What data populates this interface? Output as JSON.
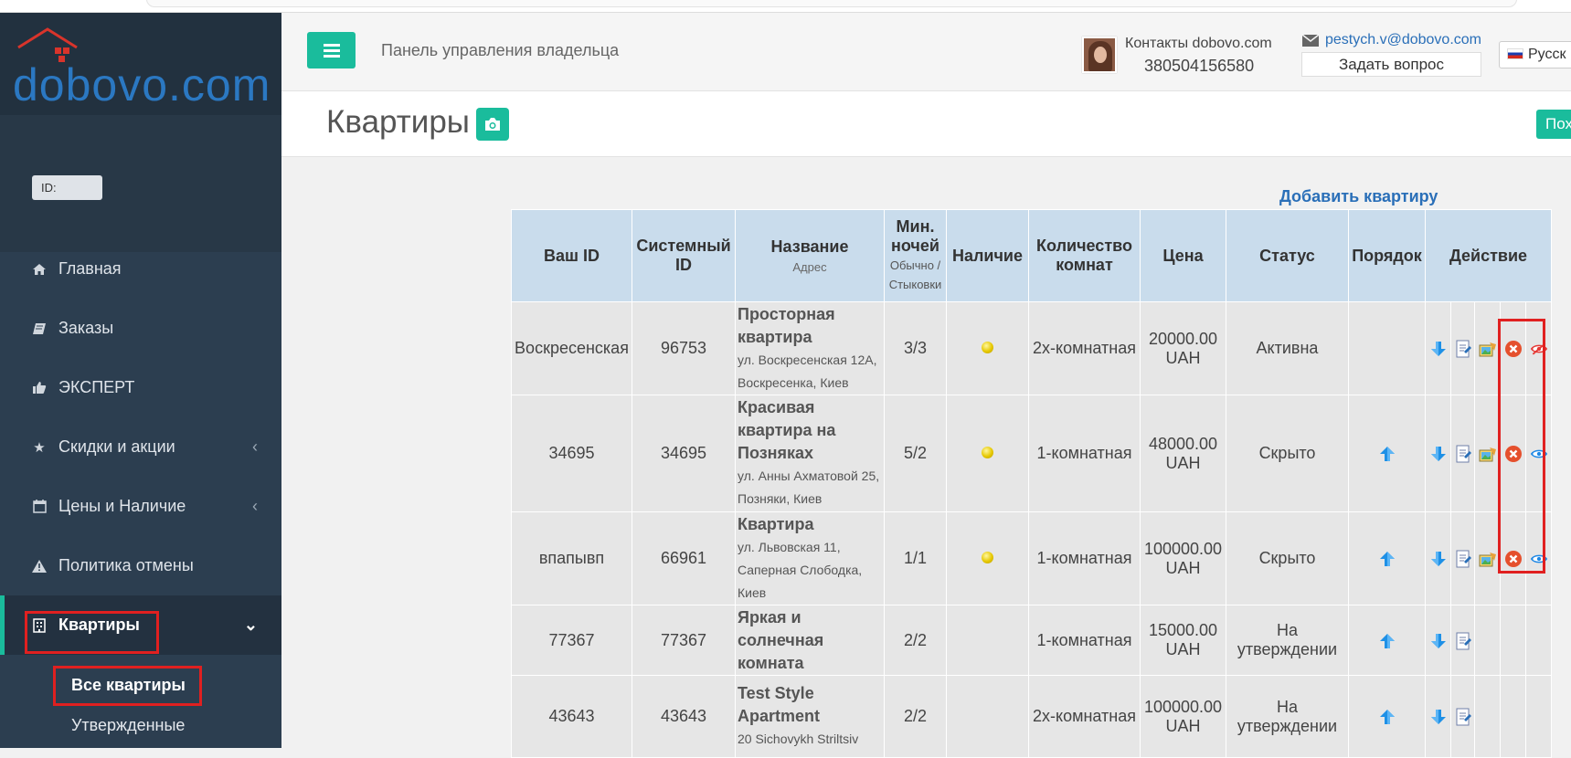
{
  "brand": {
    "logo_text": "dobovo.com"
  },
  "sidebar": {
    "id_label": "ID:",
    "menu": [
      {
        "label": "Главная",
        "icon": "home-icon"
      },
      {
        "label": "Заказы",
        "icon": "book-icon"
      },
      {
        "label": "ЭКСПЕРТ",
        "icon": "thumbs-up-icon"
      },
      {
        "label": "Скидки и акции",
        "icon": "star-icon",
        "chevron": "‹"
      },
      {
        "label": "Цены и Наличие",
        "icon": "calendar-icon",
        "chevron": "‹"
      },
      {
        "label": "Политика отмены",
        "icon": "warning-icon"
      },
      {
        "label": "Квартиры",
        "icon": "building-icon",
        "chevron": "⌄"
      }
    ],
    "submenu": [
      "Все квартиры",
      "Утвержденные"
    ]
  },
  "header": {
    "panel_title": "Панель управления владельца",
    "contacts_label": "Контакты dobovo.com",
    "phone": "380504156580",
    "email": "pestych.v@dobovo.com",
    "ask_button": "Задать вопрос",
    "language": "Русск"
  },
  "page": {
    "title": "Квартиры",
    "right_button": "Пох",
    "add_link": "Добавить квартиру"
  },
  "table": {
    "headers": {
      "your_id": "Ваш ID",
      "system_id": "Системный ID",
      "name": "Название",
      "name_sub": "Адрес",
      "min_nights": "Мин. ночей",
      "min_nights_sub": "Обычно / Стыковки",
      "availability": "Наличие",
      "rooms": "Количество комнат",
      "price": "Цена",
      "status": "Статус",
      "order": "Порядок",
      "action": "Действие"
    },
    "rows": [
      {
        "your_id": "Воскресенская",
        "system_id": "96753",
        "title": "Просторная квартира",
        "address": "ул. Воскресенская 12А, Воскресенка, Киев",
        "nights": "3/3",
        "avail": true,
        "rooms": "2х-комнатная",
        "price": "20000.00 UAH",
        "status": "Активна",
        "up": false,
        "actions": true,
        "visibility": "hidden"
      },
      {
        "your_id": "34695",
        "system_id": "34695",
        "title": "Красивая квартира на Позняках",
        "address": "ул. Анны Ахматовой 25, Позняки, Киев",
        "nights": "5/2",
        "avail": true,
        "rooms": "1-комнатная",
        "price": "48000.00 UAH",
        "status": "Скрыто",
        "up": true,
        "actions": true,
        "visibility": "visible"
      },
      {
        "your_id": "впапывп",
        "system_id": "66961",
        "title": "Квартира",
        "address": "ул. Львовская 11, Саперная Слободка, Киев",
        "nights": "1/1",
        "avail": true,
        "rooms": "1-комнатная",
        "price": "100000.00 UAH",
        "status": "Скрыто",
        "up": true,
        "actions": true,
        "visibility": "visible"
      },
      {
        "your_id": "77367",
        "system_id": "77367",
        "title": "Яркая и солнечная комната",
        "address": "",
        "nights": "2/2",
        "avail": false,
        "rooms": "1-комнатная",
        "price": "15000.00 UAH",
        "status": "На утверждении",
        "up": true,
        "actions": false,
        "visibility": ""
      },
      {
        "your_id": "43643",
        "system_id": "43643",
        "title": "Test Style Apartment",
        "address": "20 Sichovykh Striltsiv",
        "nights": "2/2",
        "avail": false,
        "rooms": "2х-комнатная",
        "price": "100000.00 UAH",
        "status": "На утверждении",
        "up": true,
        "actions": false,
        "visibility": ""
      }
    ]
  }
}
